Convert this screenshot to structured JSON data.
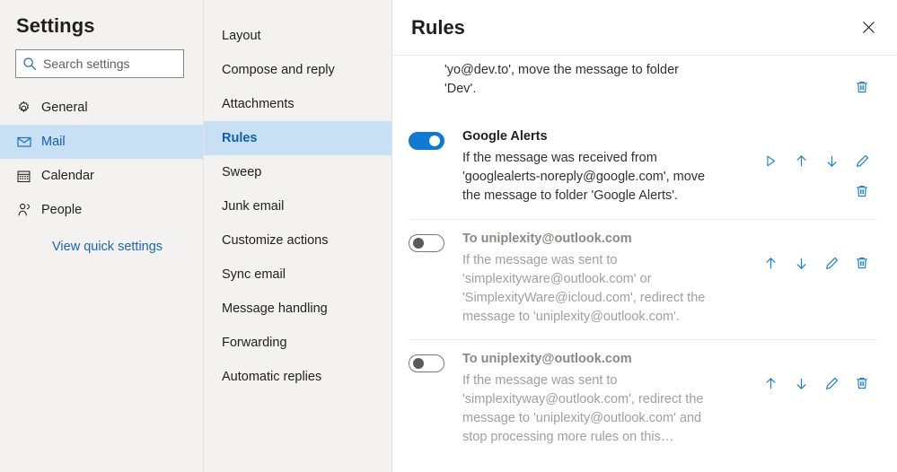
{
  "sidebar": {
    "title": "Settings",
    "search": {
      "placeholder": "Search settings",
      "value": "",
      "icon": "search-icon"
    },
    "items": [
      {
        "label": "General",
        "icon": "gear-icon",
        "selected": false
      },
      {
        "label": "Mail",
        "icon": "envelope-icon",
        "selected": true
      },
      {
        "label": "Calendar",
        "icon": "calendar-icon",
        "selected": false
      },
      {
        "label": "People",
        "icon": "people-icon",
        "selected": false
      }
    ],
    "quick_settings_link": "View quick settings"
  },
  "subnav": {
    "items": [
      {
        "label": "Layout",
        "selected": false
      },
      {
        "label": "Compose and reply",
        "selected": false
      },
      {
        "label": "Attachments",
        "selected": false
      },
      {
        "label": "Rules",
        "selected": true
      },
      {
        "label": "Sweep",
        "selected": false
      },
      {
        "label": "Junk email",
        "selected": false
      },
      {
        "label": "Customize actions",
        "selected": false
      },
      {
        "label": "Sync email",
        "selected": false
      },
      {
        "label": "Message handling",
        "selected": false
      },
      {
        "label": "Forwarding",
        "selected": false
      },
      {
        "label": "Automatic replies",
        "selected": false
      }
    ]
  },
  "main": {
    "title": "Rules",
    "close_label": "Close",
    "rules": [
      {
        "name": "",
        "description": "'yo@dev.to', move the message to folder 'Dev'.",
        "enabled": true,
        "clipped": true,
        "actions": [
          "delete-icon"
        ]
      },
      {
        "name": "Google Alerts",
        "description": "If the message was received from 'googlealerts-noreply@google.com', move the message to folder 'Google Alerts'.",
        "enabled": true,
        "clipped": false,
        "actions": [
          "run-icon",
          "move-up-icon",
          "move-down-icon",
          "edit-icon",
          "delete-icon"
        ]
      },
      {
        "name": "To uniplexity@outlook.com",
        "description": "If the message was sent to 'simplexityware@outlook.com' or 'SimplexityWare@icloud.com', redirect the message to 'uniplexity@outlook.com'.",
        "enabled": false,
        "clipped": false,
        "actions": [
          "move-up-icon",
          "move-down-icon",
          "edit-icon",
          "delete-icon"
        ]
      },
      {
        "name": "To uniplexity@outlook.com",
        "description": "If the message was sent to 'simplexityway@outlook.com', redirect the message to 'uniplexity@outlook.com' and stop processing more rules on this…",
        "enabled": false,
        "clipped": false,
        "actions": [
          "move-up-icon",
          "move-down-icon",
          "edit-icon",
          "delete-icon"
        ]
      }
    ]
  },
  "colors": {
    "accent": "#0f7ad4",
    "selection": "#c7e0f4",
    "sidebar_bg": "#f3f2f1",
    "link": "#1a66b3",
    "icon_blue": "#1a7fd4"
  }
}
